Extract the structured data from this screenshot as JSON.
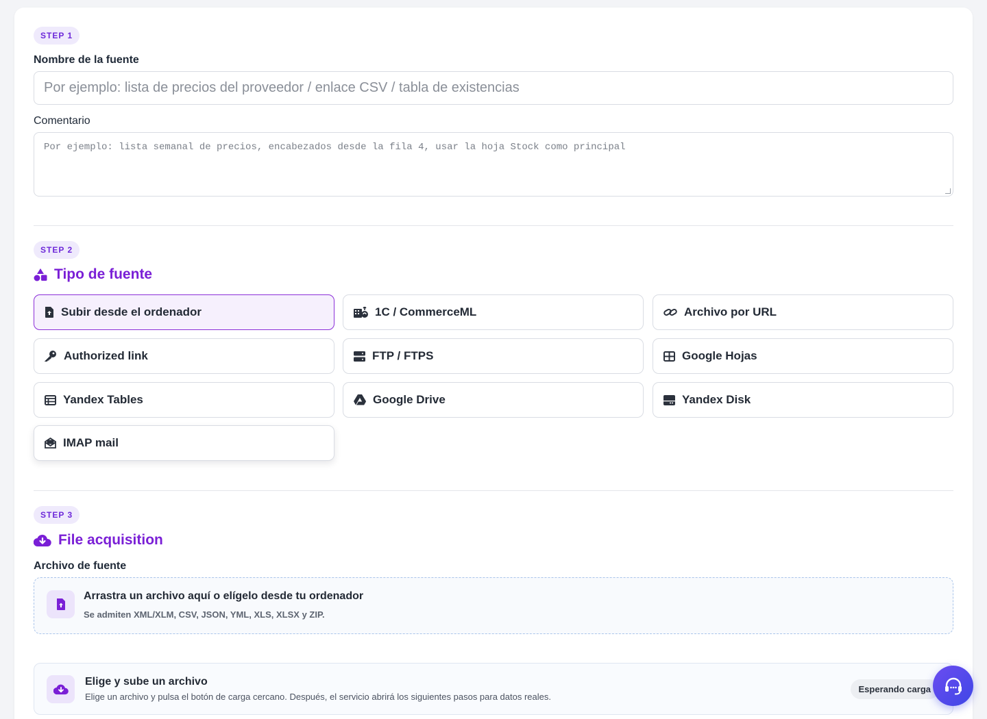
{
  "step1": {
    "badge": "STEP 1",
    "name_label": "Nombre de la fuente",
    "name_placeholder": "Por ejemplo: lista de precios del proveedor / enlace CSV / tabla de existencias",
    "comment_label": "Comentario",
    "comment_placeholder": "Por ejemplo: lista semanal de precios, encabezados desde la fila 4, usar la hoja Stock como principal"
  },
  "step2": {
    "badge": "STEP 2",
    "title": "Tipo de fuente",
    "title_icon": "shapes-icon",
    "options": [
      {
        "label": "Subir desde el ordenador",
        "icon": "file-upload-icon",
        "selected": true
      },
      {
        "label": "1C / CommerceML",
        "icon": "building-sync-icon",
        "selected": false
      },
      {
        "label": "Archivo por URL",
        "icon": "link-icon",
        "selected": false
      },
      {
        "label": "Authorized link",
        "icon": "key-icon",
        "selected": false
      },
      {
        "label": "FTP / FTPS",
        "icon": "server-icon",
        "selected": false
      },
      {
        "label": "Google Hojas",
        "icon": "table-grid-icon",
        "selected": false
      },
      {
        "label": "Yandex Tables",
        "icon": "table-list-icon",
        "selected": false
      },
      {
        "label": "Google Drive",
        "icon": "google-drive-icon",
        "selected": false
      },
      {
        "label": "Yandex Disk",
        "icon": "hard-drive-icon",
        "selected": false
      },
      {
        "label": "IMAP mail",
        "icon": "envelope-open-icon",
        "selected": false
      }
    ]
  },
  "step3": {
    "badge": "STEP 3",
    "title": "File acquisition",
    "title_icon": "cloud-download-icon",
    "file_label": "Archivo de fuente",
    "drop_title": "Arrastra un archivo aquí o elígelo desde tu ordenador",
    "drop_subtitle": "Se admiten XML/XLM, CSV, JSON, YML, XLS, XLSX y ZIP.",
    "panel_title": "Elige y sube un archivo",
    "panel_subtitle": "Elige un archivo y pulsa el botón de carga cercano. Después, el servicio abrirá los siguientes pasos para datos reales.",
    "status": "Esperando carga"
  },
  "support_button": "headset-icon",
  "colors": {
    "accent": "#7a1fd6",
    "badge_bg": "#efeafc",
    "fab": "#4f46e5"
  }
}
